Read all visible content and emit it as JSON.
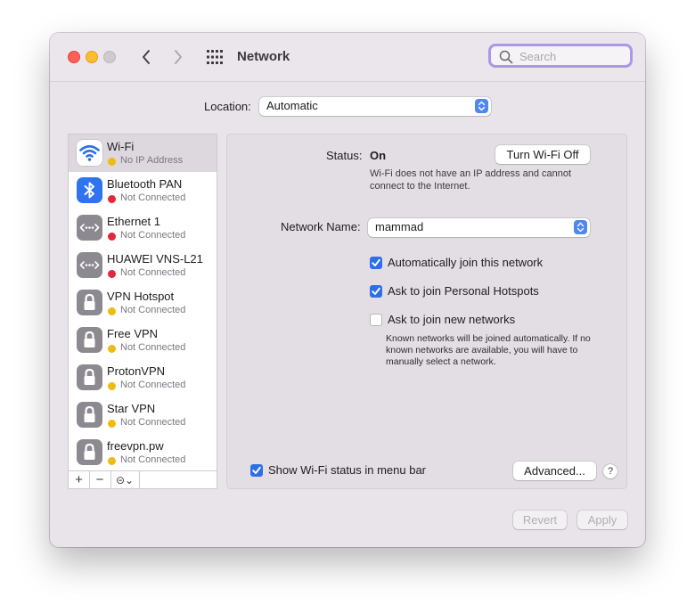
{
  "window": {
    "title": "Network",
    "search_placeholder": "Search"
  },
  "location": {
    "label": "Location:",
    "value": "Automatic"
  },
  "services": [
    {
      "name": "Wi-Fi",
      "status": "No IP Address",
      "status_color": "#f0bb11",
      "icon": "wifi-icon",
      "selected": true
    },
    {
      "name": "Bluetooth PAN",
      "status": "Not Connected",
      "status_color": "#e6273b",
      "icon": "bluetooth-icon"
    },
    {
      "name": "Ethernet 1",
      "status": "Not Connected",
      "status_color": "#e6273b",
      "icon": "ethernet-icon"
    },
    {
      "name": "HUAWEI VNS-L21",
      "status": "Not Connected",
      "status_color": "#e6273b",
      "icon": "ethernet-icon"
    },
    {
      "name": "VPN Hotspot",
      "status": "Not Connected",
      "status_color": "#f0bb11",
      "icon": "lock-icon"
    },
    {
      "name": "Free VPN",
      "status": "Not Connected",
      "status_color": "#f0bb11",
      "icon": "lock-icon"
    },
    {
      "name": "ProtonVPN",
      "status": "Not Connected",
      "status_color": "#f0bb11",
      "icon": "lock-icon"
    },
    {
      "name": "Star VPN",
      "status": "Not Connected",
      "status_color": "#f0bb11",
      "icon": "lock-icon"
    },
    {
      "name": "freevpn.pw",
      "status": "Not Connected",
      "status_color": "#f0bb11",
      "icon": "lock-icon"
    }
  ],
  "sidebar_toolbar": {
    "add": "+",
    "remove": "−",
    "action": "⊝⌄"
  },
  "detail": {
    "status_label": "Status:",
    "status_value": "On",
    "turn_off_button": "Turn Wi-Fi Off",
    "status_description": "Wi-Fi does not have an IP address and cannot connect to the Internet.",
    "network_name_label": "Network Name:",
    "network_name_value": "mammad",
    "auto_join": {
      "label": "Automatically join this network",
      "checked": true
    },
    "ask_hotspots": {
      "label": "Ask to join Personal Hotspots",
      "checked": true
    },
    "ask_new": {
      "label": "Ask to join new networks",
      "checked": false
    },
    "known_networks_note": "Known networks will be joined automatically. If no known networks are available, you will have to manually select a network.",
    "show_status": {
      "label": "Show Wi-Fi status in menu bar",
      "checked": true
    },
    "advanced_button": "Advanced...",
    "help_button": "?"
  },
  "footer": {
    "revert_button": "Revert",
    "apply_button": "Apply"
  },
  "colors": {
    "accent": "#2f6fe6",
    "search_focus_ring": "#a998e6",
    "status_yellow": "#f0bb11",
    "status_red": "#e6273b"
  }
}
